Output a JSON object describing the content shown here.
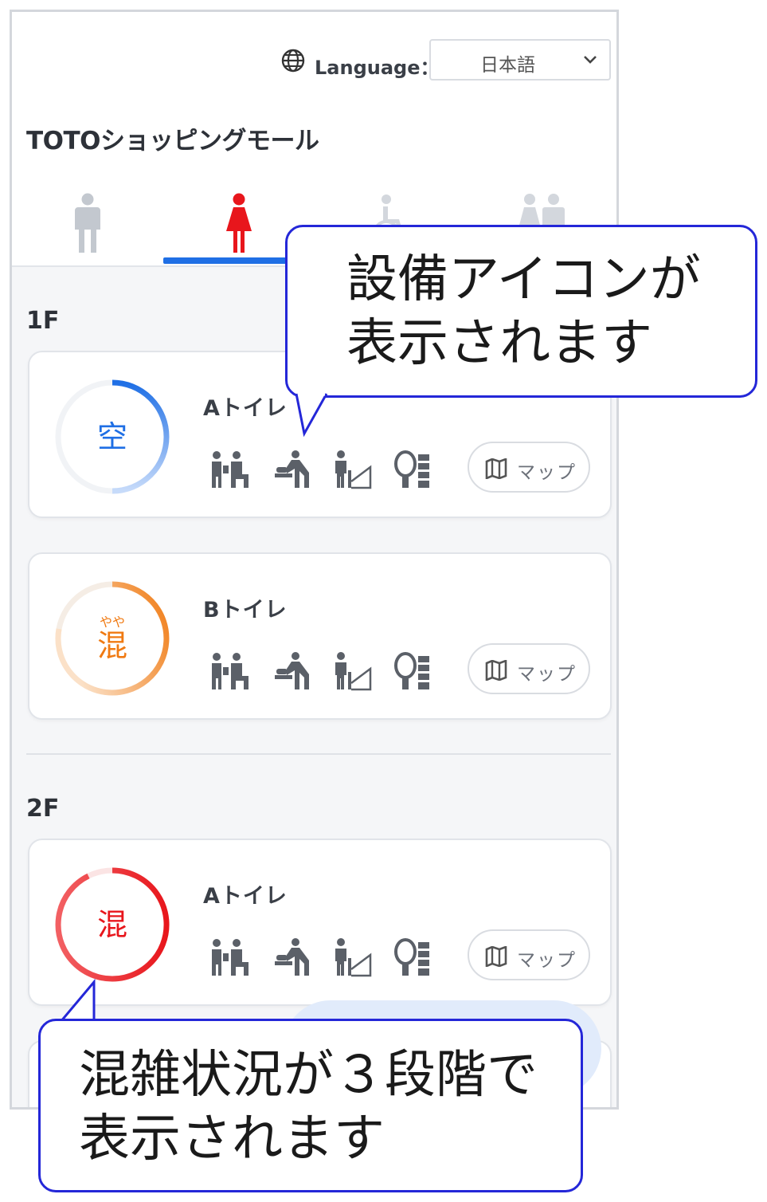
{
  "language": {
    "label": "Language：",
    "selected": "日本語"
  },
  "mall_title": "TOTOショッピングモール",
  "tabs": [
    {
      "name": "男性",
      "icon": "male-icon",
      "active": false
    },
    {
      "name": "女性",
      "icon": "female-icon",
      "active": true
    },
    {
      "name": "多目的",
      "icon": "wheelchair-icon",
      "active": false
    },
    {
      "name": "家族",
      "icon": "family-icon",
      "active": false
    }
  ],
  "floors": [
    {
      "label": "1F",
      "toilets": [
        {
          "name": "Aトイレ",
          "status_main": "空",
          "status_sub": "",
          "status": "空き",
          "color": "#1f6fe5",
          "map_label": "マップ"
        },
        {
          "name": "Bトイレ",
          "status_main": "混",
          "status_sub": "やや",
          "status": "やや混雑",
          "color": "#f07a12",
          "map_label": "マップ"
        }
      ]
    },
    {
      "label": "2F",
      "toilets": [
        {
          "name": "Aトイレ",
          "status_main": "混",
          "status_sub": "",
          "status": "混雑",
          "color": "#e8161c",
          "map_label": "マップ"
        }
      ]
    }
  ],
  "facility_icons": [
    "baby-seat-icon",
    "diaper-changing-icon",
    "fitting-board-icon",
    "powder-room-icon"
  ],
  "callouts": {
    "facility": {
      "line1": "設備アイコンが",
      "line2": "表示されます"
    },
    "congestion": {
      "line1": "混雑状況が３段階で",
      "line2": "表示されます"
    }
  }
}
